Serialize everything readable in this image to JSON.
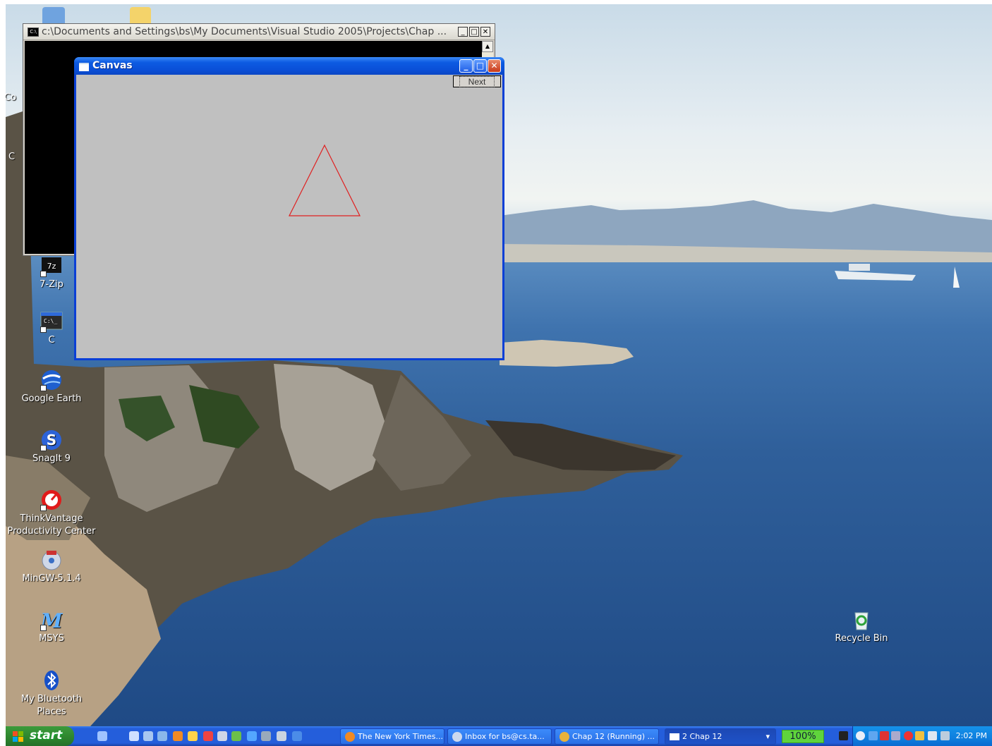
{
  "console_window": {
    "title": "c:\\Documents and Settings\\bs\\My Documents\\Visual Studio 2005\\Projects\\Chap ...",
    "icon_label": "C:\\"
  },
  "canvas_window": {
    "title": "Canvas",
    "next_button": "Next",
    "triangle_color": "#e02020"
  },
  "desktop_icons": [
    {
      "label": "7-Zip"
    },
    {
      "label": "C"
    },
    {
      "label": "Google Earth"
    },
    {
      "label": "SnagIt 9"
    },
    {
      "label": "ThinkVantage Productivity Center"
    },
    {
      "label": "MinGW-5.1.4"
    },
    {
      "label": "MSYS"
    },
    {
      "label": "My Bluetooth Places"
    },
    {
      "label": "Recycle Bin"
    }
  ],
  "partial_icon_labels": {
    "co": "Co",
    "c": "C"
  },
  "taskbar": {
    "start_label": "start",
    "tasks": [
      {
        "label": "The New York Times..."
      },
      {
        "label": "Inbox for bs@cs.ta..."
      },
      {
        "label": "Chap 12 (Running) ..."
      },
      {
        "label": "2 Chap 12"
      }
    ],
    "zoom": "100%",
    "clock": "2:02 PM"
  },
  "colors": {
    "xp_blue": "#245edb",
    "start_green": "#2c842c",
    "canvas_bg": "#c0c0c0"
  }
}
